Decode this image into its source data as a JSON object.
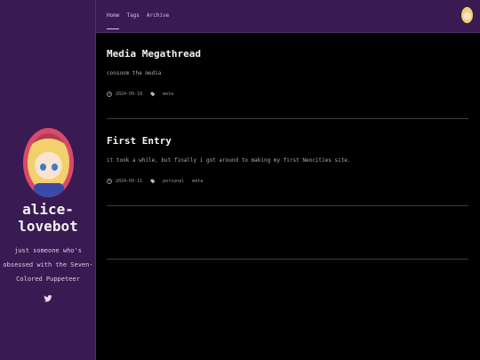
{
  "sidebar": {
    "site_name": "alice-lovebot",
    "tagline": "just someone who's obsessed with the Seven-Colored Puppeteer",
    "social_icon": "twitter-icon"
  },
  "nav": {
    "items": [
      "Home",
      "Tags",
      "Archive"
    ],
    "active": "Home"
  },
  "posts": [
    {
      "title": "Media Megathread",
      "excerpt": "consoom the media",
      "date": "2024-09-18",
      "tags": [
        "meta"
      ]
    },
    {
      "title": "First Entry",
      "excerpt": "it took a while, but finally i got around to making my first Neocities site.",
      "date": "2024-09-11",
      "tags": [
        "personal",
        "meta"
      ]
    }
  ],
  "colors": {
    "sidebar_bg": "#3a1a52",
    "main_bg": "#000000",
    "avatar_ring": "#d94a6a"
  }
}
